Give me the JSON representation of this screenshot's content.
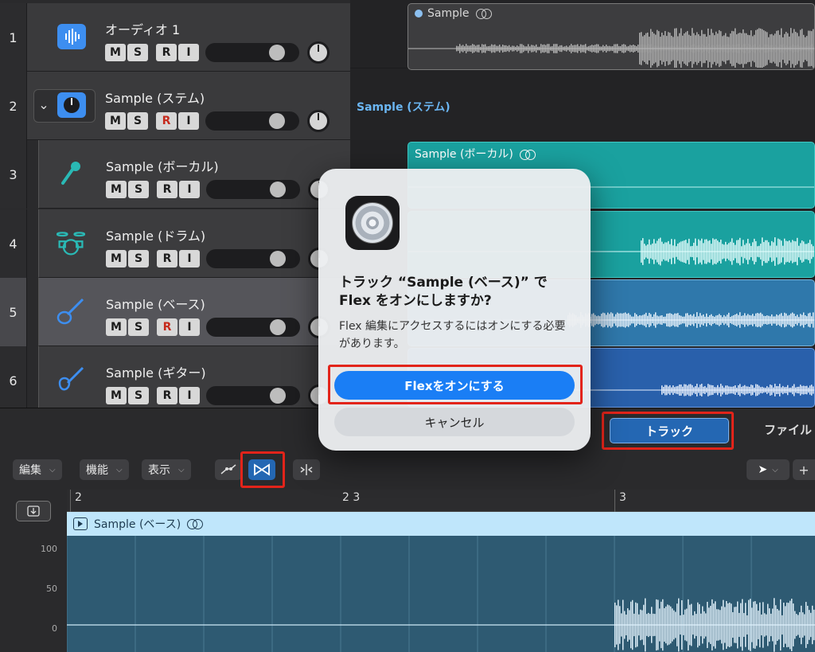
{
  "tracks": [
    {
      "num": "1",
      "name": "オーディオ 1",
      "r_armed": false
    },
    {
      "num": "2",
      "name": "Sample (ステム)",
      "r_armed": true
    },
    {
      "num": "3",
      "name": "Sample (ボーカル)",
      "r_armed": false
    },
    {
      "num": "4",
      "name": "Sample (ドラム)",
      "r_armed": false
    },
    {
      "num": "5",
      "name": "Sample (ベース)",
      "r_armed": true
    },
    {
      "num": "6",
      "name": "Sample (ギター)",
      "r_armed": false
    }
  ],
  "track_buttons": {
    "mute": "M",
    "solo": "S",
    "record": "R",
    "input": "I"
  },
  "regions": {
    "audio1": "Sample",
    "stem": "Sample (ステム)",
    "vocal": "Sample (ボーカル)"
  },
  "dialog": {
    "title": "トラック “Sample (ベース)” でFlex をオンにしますか?",
    "message": "Flex 編集にアクセスするにはオンにする必要があります。",
    "primary": "Flexをオンにする",
    "cancel": "キャンセル"
  },
  "tabs": {
    "track": "トラック",
    "file": "ファイル"
  },
  "editor_menus": {
    "edit": "編集",
    "function": "機能",
    "view": "表示"
  },
  "ruler": {
    "m1": "2",
    "m2": "2 3",
    "m3": "3"
  },
  "editor_region": {
    "name": "Sample (ベース)"
  },
  "y_axis": [
    "100",
    "50",
    "0"
  ],
  "colors": {
    "accent": "#1a7ef5",
    "highlight": "#e2241a",
    "teal": "#1aa19f",
    "blue_region": "#2f78ab"
  }
}
